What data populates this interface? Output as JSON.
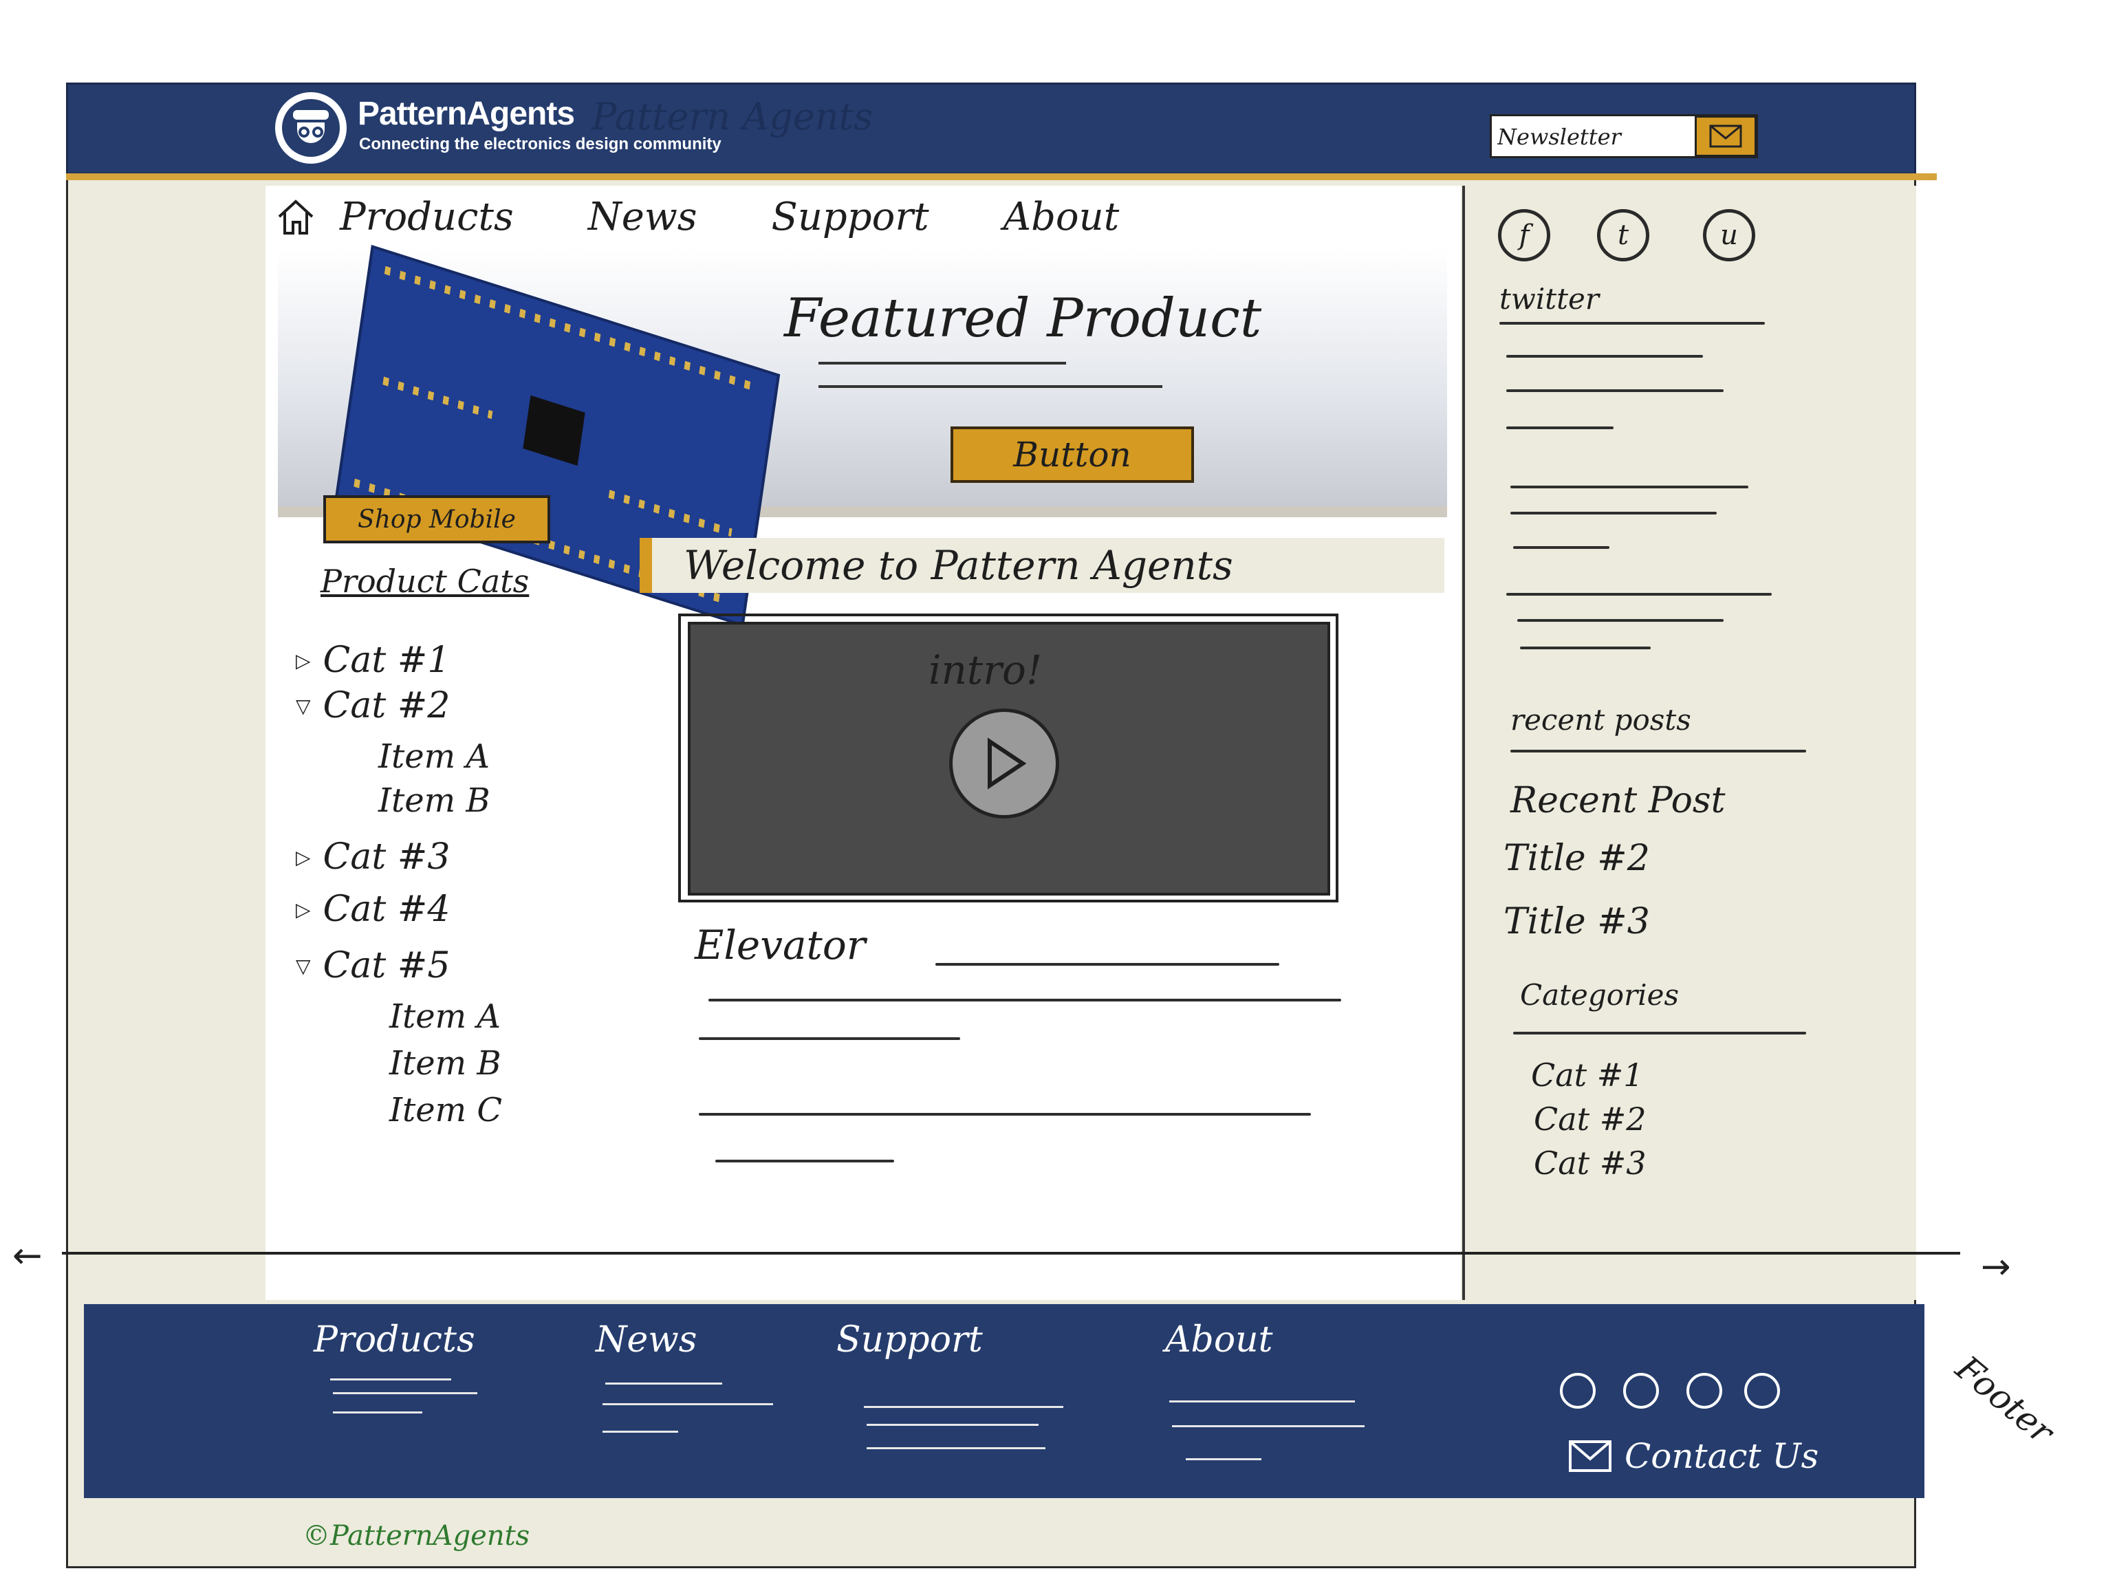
{
  "brand": {
    "name": "PatternAgents",
    "tagline": "Connecting the electronics design community",
    "sketch_name": "Pattern Agents"
  },
  "header": {
    "newsletter_placeholder": "Newsletter",
    "newsletter_button_icon": "envelope-icon"
  },
  "nav": {
    "home_icon": "home-icon",
    "items": [
      "Products",
      "News",
      "Support",
      "About"
    ]
  },
  "hero": {
    "title": "Featured Product",
    "button": "Button",
    "image": "circuit-board"
  },
  "shop_mobile": "Shop Mobile",
  "welcome": "Welcome to Pattern Agents",
  "product_cats": {
    "heading": "Product Cats",
    "cat1": "Cat #1",
    "cat2": "Cat #2",
    "cat2_items": [
      "Item A",
      "Item B"
    ],
    "cat3": "Cat #3",
    "cat4": "Cat #4",
    "cat5": "Cat #5",
    "cat5_items": [
      "Item A",
      "Item B",
      "Item C"
    ]
  },
  "video": {
    "label": "intro!",
    "play_icon": "play-icon"
  },
  "elevator": "Elevator",
  "sidebar": {
    "social_icons": [
      "facebook-icon",
      "twitter-icon",
      "other-icon"
    ],
    "twitter_heading": "twitter",
    "recent_heading": "recent posts",
    "recent_posts": [
      "Recent Post",
      "Title #2",
      "Title #3"
    ],
    "categories_heading": "Categories",
    "categories": [
      "Cat #1",
      "Cat #2",
      "Cat #3"
    ]
  },
  "footer": {
    "columns": [
      "Products",
      "News",
      "Support",
      "About"
    ],
    "contact": "Contact Us",
    "note": "Footer",
    "copyright": "©PatternAgents"
  },
  "colors": {
    "navy": "#253c6d",
    "gold": "#d49a22",
    "cream": "#ecebdd"
  }
}
